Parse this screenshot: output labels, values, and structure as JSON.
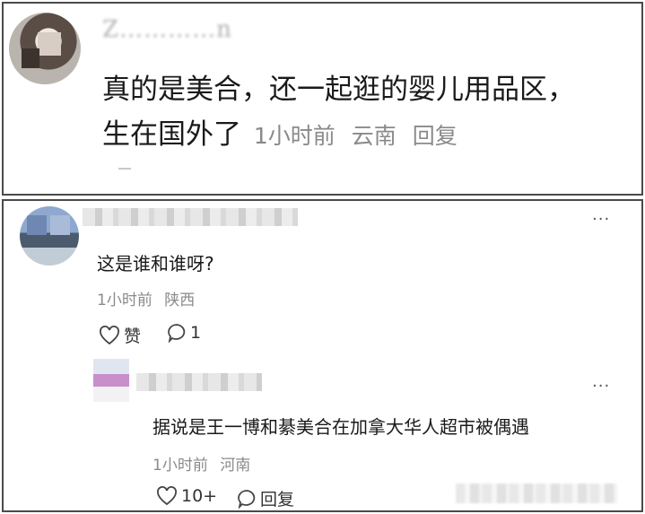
{
  "post": {
    "username": "Z…………n",
    "line1": "真的是美合，还一起逛的婴儿用品区，",
    "line2": "生在国外了",
    "time": "1小时前",
    "location": "云南",
    "reply_label": "回复"
  },
  "comment": {
    "text": "这是谁和谁呀?",
    "time": "1小时前",
    "location": "陕西",
    "like_label": "赞",
    "reply_count": "1",
    "more_label": "···"
  },
  "reply": {
    "text": "据说是王一博和綦美合在加拿大华人超市被偶遇",
    "time": "1小时前",
    "location": "河南",
    "like_count": "10+",
    "reply_label": "回复",
    "more_label": "···"
  }
}
